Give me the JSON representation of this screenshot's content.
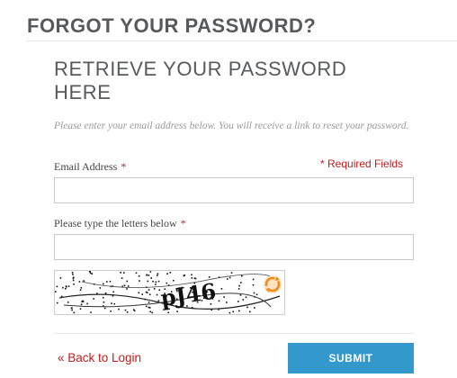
{
  "header": {
    "title": "FORGOT YOUR PASSWORD?"
  },
  "form": {
    "section_title": "RETRIEVE YOUR PASSWORD HERE",
    "instructions": "Please enter your email address below. You will receive a link to reset your password.",
    "required_note": "* Required Fields",
    "email": {
      "label": "Email Address",
      "required_mark": "*",
      "value": ""
    },
    "captcha": {
      "label": "Please type the letters below",
      "required_mark": "*",
      "value": "",
      "image_text": "pJ46"
    },
    "back_link": "« Back to Login",
    "submit_label": "SUBMIT"
  },
  "colors": {
    "heading": "#58595b",
    "required": "#c41b1b",
    "button": "#3399cc",
    "refresh_icon": "#f08c1e"
  },
  "icons": {
    "refresh": "refresh-icon"
  }
}
